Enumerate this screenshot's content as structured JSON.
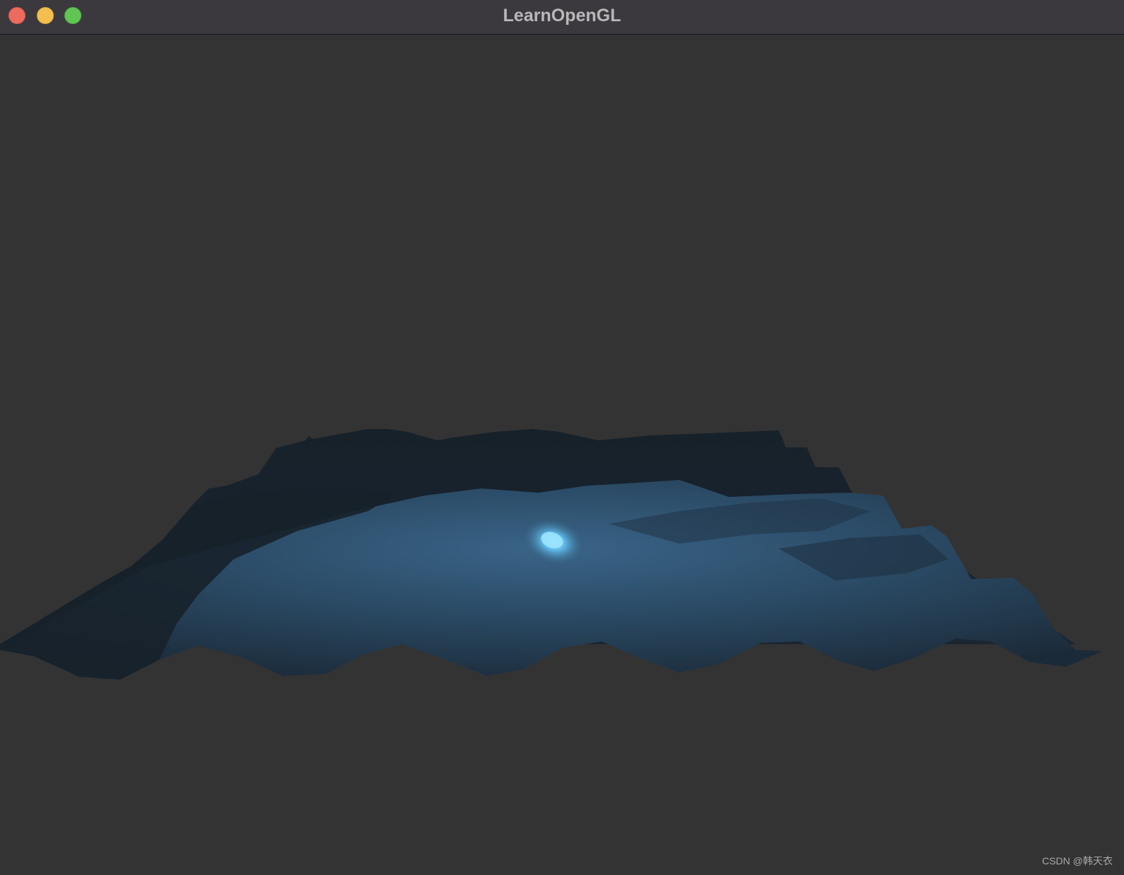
{
  "window": {
    "title": "LearnOpenGL"
  },
  "watermark": {
    "text": "CSDN @韩天衣"
  },
  "colors": {
    "background": "#333333",
    "titlebar": "#3c393e",
    "terrain_dark": "#17212a",
    "terrain_lit": "#2c4e6a",
    "highlight": "#7fd3ff"
  },
  "icons": {
    "close": "close-traffic-light-icon",
    "minimize": "minimize-traffic-light-icon",
    "maximize": "maximize-traffic-light-icon"
  }
}
